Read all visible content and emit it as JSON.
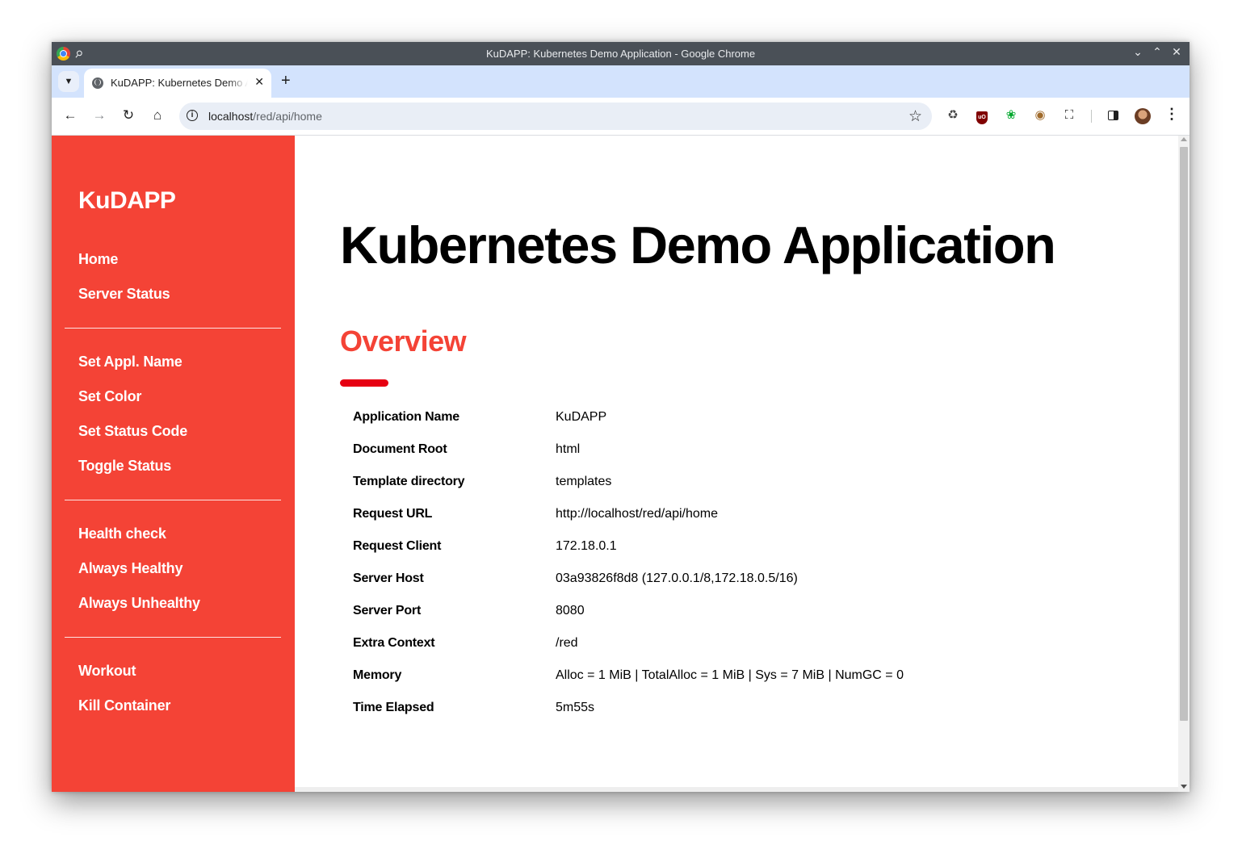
{
  "window": {
    "title": "KuDAPP: Kubernetes Demo Application - Google Chrome"
  },
  "tab": {
    "title": "KuDAPP: Kubernetes Demo Application"
  },
  "address_bar": {
    "host": "localhost",
    "path": "/red/api/home"
  },
  "icons": {
    "minimize": "chevron-down-icon",
    "maximize": "chevron-up-icon",
    "close": "close-icon"
  },
  "sidebar": {
    "brand": "KuDAPP",
    "groups": [
      {
        "items": [
          {
            "label": "Home"
          },
          {
            "label": "Server Status"
          }
        ]
      },
      {
        "items": [
          {
            "label": "Set Appl. Name"
          },
          {
            "label": "Set Color"
          },
          {
            "label": "Set Status Code"
          },
          {
            "label": "Toggle Status"
          }
        ]
      },
      {
        "items": [
          {
            "label": "Health check"
          },
          {
            "label": "Always Healthy"
          },
          {
            "label": "Always Unhealthy"
          }
        ]
      },
      {
        "items": [
          {
            "label": "Workout"
          },
          {
            "label": "Kill Container"
          }
        ]
      }
    ]
  },
  "main": {
    "title": "Kubernetes Demo Application",
    "section_title": "Overview",
    "rows": [
      {
        "key": "Application Name",
        "value": "KuDAPP"
      },
      {
        "key": "Document Root",
        "value": "html"
      },
      {
        "key": "Template directory",
        "value": "templates"
      },
      {
        "key": "Request URL",
        "value": "http://localhost/red/api/home"
      },
      {
        "key": "Request Client",
        "value": "172.18.0.1"
      },
      {
        "key": "Server Host",
        "value": "03a93826f8d8 (127.0.0.1/8,172.18.0.5/16)"
      },
      {
        "key": "Server Port",
        "value": "8080"
      },
      {
        "key": "Extra Context",
        "value": "/red"
      },
      {
        "key": "Memory",
        "value": "Alloc = 1 MiB | TotalAlloc = 1 MiB | Sys = 7 MiB | NumGC = 0"
      },
      {
        "key": "Time Elapsed",
        "value": "5m55s"
      }
    ]
  },
  "colors": {
    "sidebar_bg": "#f44336",
    "accent": "#f44336",
    "section_bar": "#e60012"
  }
}
